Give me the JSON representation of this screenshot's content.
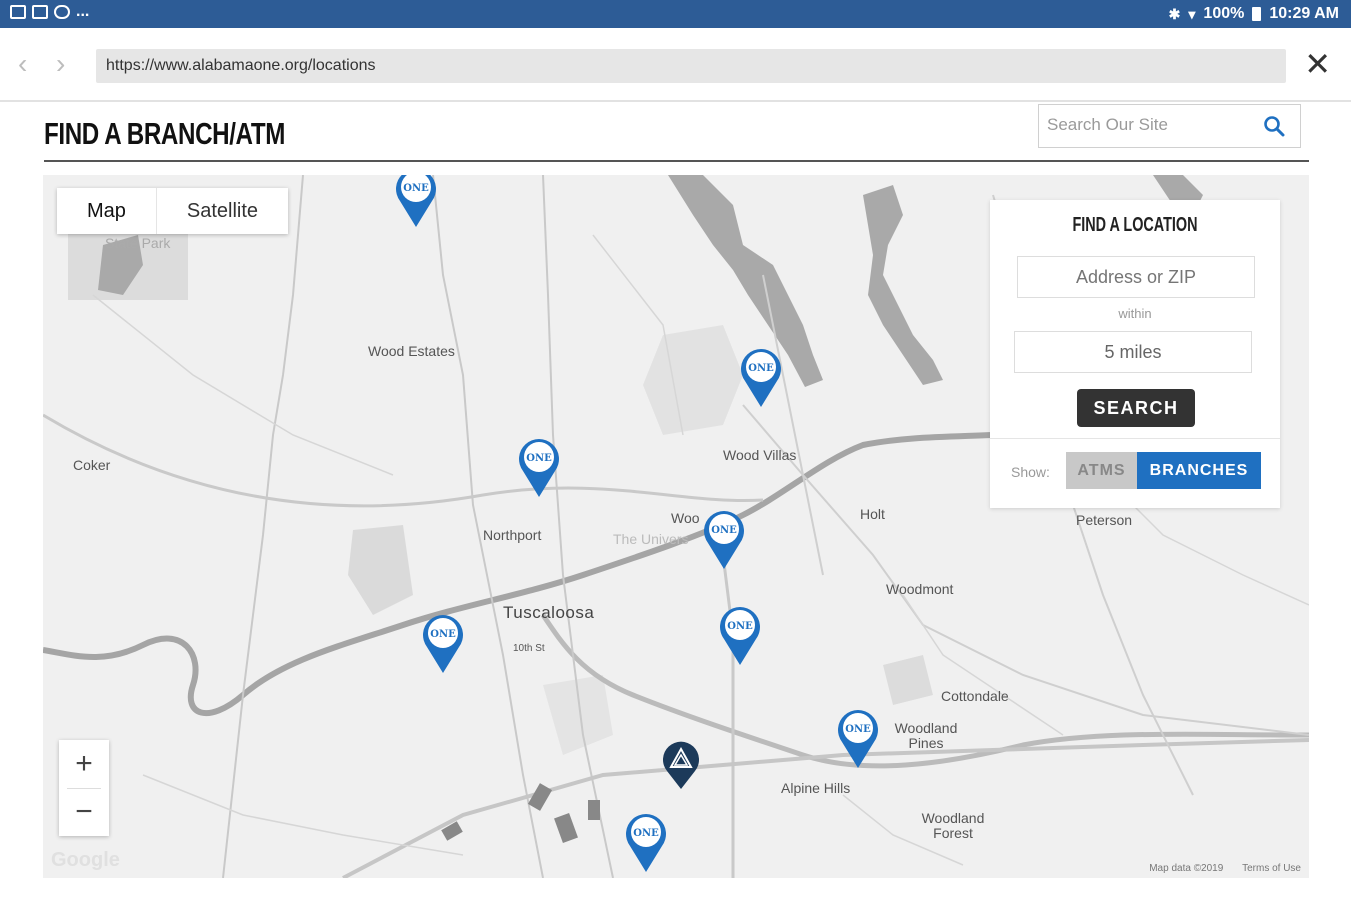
{
  "status_bar": {
    "battery": "100%",
    "time": "10:29 AM",
    "overflow": "..."
  },
  "browser": {
    "url": "https://www.alabamaone.org/locations",
    "back_glyph": "‹",
    "forward_glyph": "›",
    "close_glyph": "✕"
  },
  "page": {
    "title": "FIND A BRANCH/ATM",
    "search_placeholder": "Search Our Site"
  },
  "map": {
    "map_type": {
      "map_label": "Map",
      "satellite_label": "Satellite",
      "selected": "Map"
    },
    "zoom_in": "+",
    "zoom_out": "−",
    "google_logo": "Google",
    "map_data": "Map data ©2019",
    "terms": "Terms of Use",
    "marker_label": "ONE",
    "places": {
      "wood_estates": "Wood Estates",
      "coker": "Coker",
      "wood_villas": "Wood Villas",
      "holt": "Holt",
      "peterson": "Peterson",
      "northport": "Northport",
      "the_university": "The Univers",
      "tuscaloosa": "Tuscaloosa",
      "woodmont": "Woodmont",
      "cottondale": "Cottondale",
      "woodland_pines": "Woodland Pines",
      "alpine_hills": "Alpine Hills",
      "woodland_forest": "Woodland Forest",
      "state_park": "State Park",
      "tenth_st": "10th St",
      "woo": "Woo"
    },
    "branch_color": "#1f70c1",
    "current_location_color": "#1c3a5a"
  },
  "finder": {
    "title": "FIND A LOCATION",
    "address_placeholder": "Address or ZIP",
    "within_label": "within",
    "miles_value": "5 miles",
    "search_button": "SEARCH",
    "show_label": "Show:",
    "atms_label": "ATMS",
    "branches_label": "BRANCHES",
    "selected_filter": "BRANCHES"
  }
}
